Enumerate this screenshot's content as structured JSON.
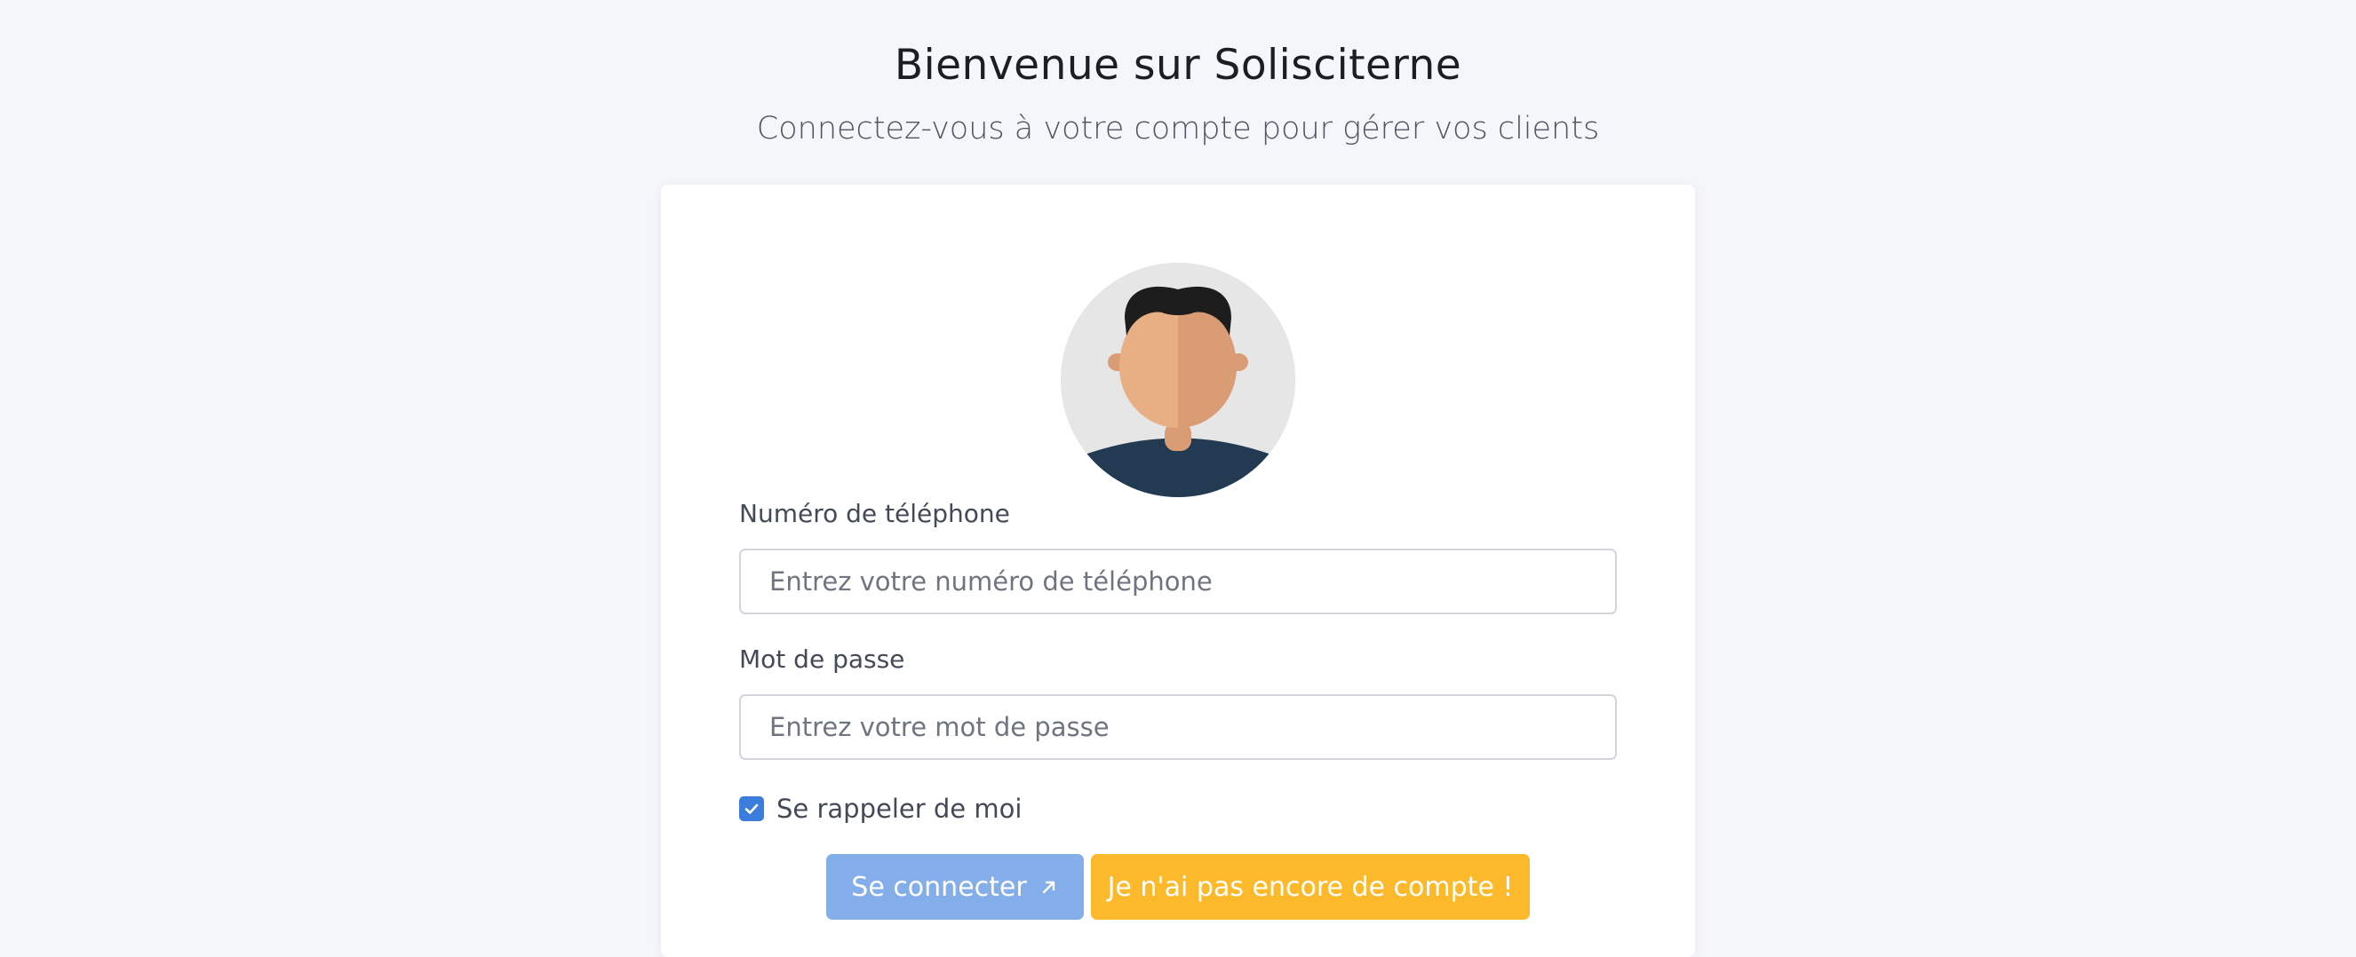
{
  "header": {
    "title": "Bienvenue sur Solisciterne",
    "subtitle": "Connectez-vous à votre compte pour gérer vos clients"
  },
  "form": {
    "avatar_icon": "user-avatar-icon",
    "phone": {
      "label": "Numéro de téléphone",
      "placeholder": "Entrez votre numéro de téléphone",
      "value": ""
    },
    "password": {
      "label": "Mot de passe",
      "placeholder": "Entrez votre mot de passe",
      "value": ""
    },
    "remember": {
      "label": "Se rappeler de moi",
      "checked": true
    },
    "buttons": {
      "login_label": "Se connecter",
      "login_icon": "arrow-up-right-icon",
      "signup_label": "Je n'ai pas encore de compte !"
    }
  },
  "colors": {
    "background": "#f5f6f9",
    "card": "#ffffff",
    "primary": "#3b7ddd",
    "primary_light": "#84aee9",
    "warning": "#fcb92c",
    "avatar_bg": "#e6e6e6",
    "skin_light": "#e8ae84",
    "skin_dark": "#d99c74",
    "hair": "#1d1d1d",
    "shirt": "#223a52"
  }
}
